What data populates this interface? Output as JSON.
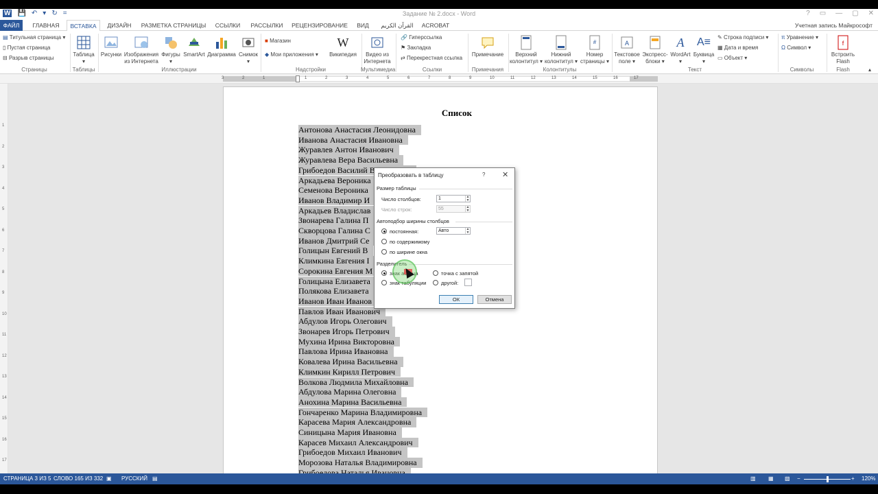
{
  "titlebar": {
    "title": "Задание № 2.docx - Word",
    "qat": [
      "W",
      "💾",
      "↶",
      "▾",
      "↻",
      "="
    ],
    "window_buttons": [
      "?",
      "▭",
      "—",
      "▢",
      "✕"
    ]
  },
  "tabs": {
    "file": "ФАЙЛ",
    "items": [
      "ГЛАВНАЯ",
      "ВСТАВКА",
      "ДИЗАЙН",
      "РАЗМЕТКА СТРАНИЦЫ",
      "ССЫЛКИ",
      "РАССЫЛКИ",
      "РЕЦЕНЗИРОВАНИЕ",
      "ВИД",
      "القرآن الكريم",
      "ACROBAT"
    ],
    "active": "ВСТАВКА",
    "account": "Учетная запись Майкрософт"
  },
  "ribbon": {
    "pages": {
      "title_page": "Титульная страница",
      "blank_page": "Пустая страница",
      "page_break": "Разрыв страницы",
      "group": "Страницы"
    },
    "tables": {
      "table": "Таблица",
      "group": "Таблицы"
    },
    "illustrations": {
      "pictures": "Рисунки",
      "online1": "Изображения",
      "online2": "из Интернета",
      "shapes": "Фигуры",
      "smartart": "SmartArt",
      "chart": "Диаграмма",
      "screenshot": "Снимок",
      "group": "Иллюстрации"
    },
    "addins": {
      "store": "Магазин",
      "my_apps": "Мои приложения",
      "wikipedia": "Википедия",
      "group": "Надстройки"
    },
    "media": {
      "video1": "Видео из",
      "video2": "Интернета",
      "group": "Мультимедиа"
    },
    "links": {
      "hyperlink": "Гиперссылка",
      "bookmark": "Закладка",
      "crossref": "Перекрестная ссылка",
      "group": "Ссылки"
    },
    "comments": {
      "comment": "Примечание",
      "group": "Примечания"
    },
    "headers": {
      "header1": "Верхний",
      "header2": "колонтитул",
      "footer1": "Нижний",
      "footer2": "колонтитул",
      "pagenum1": "Номер",
      "pagenum2": "страницы",
      "group": "Колонтитулы"
    },
    "text": {
      "textbox1": "Текстовое",
      "textbox2": "поле",
      "express1": "Экспресс-",
      "express2": "блоки",
      "wordart": "WordArt",
      "dropcap": "Буквица",
      "signature": "Строка подписи",
      "datetime": "Дата и время",
      "object": "Объект",
      "group": "Текст"
    },
    "symbols": {
      "equation": "Уравнение",
      "symbol": "Символ",
      "group": "Символы"
    },
    "flash": {
      "embed1": "Встроить",
      "embed2": "Flash",
      "group": "Flash"
    }
  },
  "ruler": {
    "h_numbers": [
      "3",
      "2",
      "1",
      "1",
      "2",
      "3",
      "4",
      "5",
      "6",
      "7",
      "8",
      "9",
      "10",
      "11",
      "12",
      "13",
      "14",
      "15",
      "16",
      "17"
    ],
    "v_numbers": [
      "1",
      "2",
      "3",
      "4",
      "5",
      "6",
      "7",
      "8",
      "9",
      "10",
      "11",
      "12",
      "13",
      "14",
      "15",
      "16",
      "17"
    ]
  },
  "document": {
    "heading": "Список",
    "lines": [
      "Антонова Анастасия Леонидовна",
      "Иванова Анастасия Ивановна",
      "Журавлев Антон Иванович",
      "Журавлева Вера Васильевна",
      "Грибоедов Василий Васильевич",
      "Аркадьева Вероника",
      "Семенова Вероника",
      "Иванов Владимир И",
      "Аркадьев Владислав",
      "Звонарева Галина П",
      "Скворцова Галина С",
      "Иванов Дмитрий Се",
      "Голицын Евгений В",
      "Климкина Евгения І",
      "Сорокина Евгения М",
      "Голицына Елизавета",
      "Полякова Елизавета",
      "Иванов Иван Иванов",
      "Павлов Иван Иванович",
      "Абдулов Игорь Олегович",
      "Звонарев Игорь Петрович",
      "Мухина Ирина Викторовна",
      "Павлова Ирина Ивановна",
      "Ковалева Ирина Васильевна",
      "Климкин Кирилл Петрович",
      "Волкова Людмила Михайловна",
      "Абдулова Марина Олеговна",
      "Анохина Марина Васильевна",
      "Гончаренко Марина Владимировна",
      "Карасева Мария Александровна",
      "Синицына Мария Ивановна",
      "Карасев Михаил Александрович",
      "Грибоедов Михаил Иванович",
      "Морозова Наталья Владимировна",
      "Грибоедова Наталья Ивановна"
    ]
  },
  "dialog": {
    "title": "Преобразовать в таблицу",
    "help": "?",
    "close": "✕",
    "size_section": "Размер таблицы",
    "cols_label": "Число столбцов:",
    "cols_value": "1",
    "rows_label": "Число строк:",
    "rows_value": "55",
    "autofit_section": "Автоподбор ширины столбцов",
    "fixed_label": "постоянная:",
    "fixed_value": "Авто",
    "content_label": "по содержимому",
    "window_label": "по ширине окна",
    "separator_section": "Разделитель",
    "paragraph_label": "знак абзаца",
    "tab_label": "знак табуляции",
    "semicolon_label": "точка с запятой",
    "other_label": "другой:",
    "ok": "ОК",
    "cancel": "Отмена"
  },
  "status": {
    "page": "СТРАНИЦА 3 ИЗ 5",
    "words": "СЛОВО 165 ИЗ 332",
    "language": "РУССКИЙ",
    "zoom": "120%"
  },
  "colors": {
    "accent": "#2b579a",
    "selection": "#c5c5c5",
    "cursor_highlight": "#8cdc82"
  }
}
